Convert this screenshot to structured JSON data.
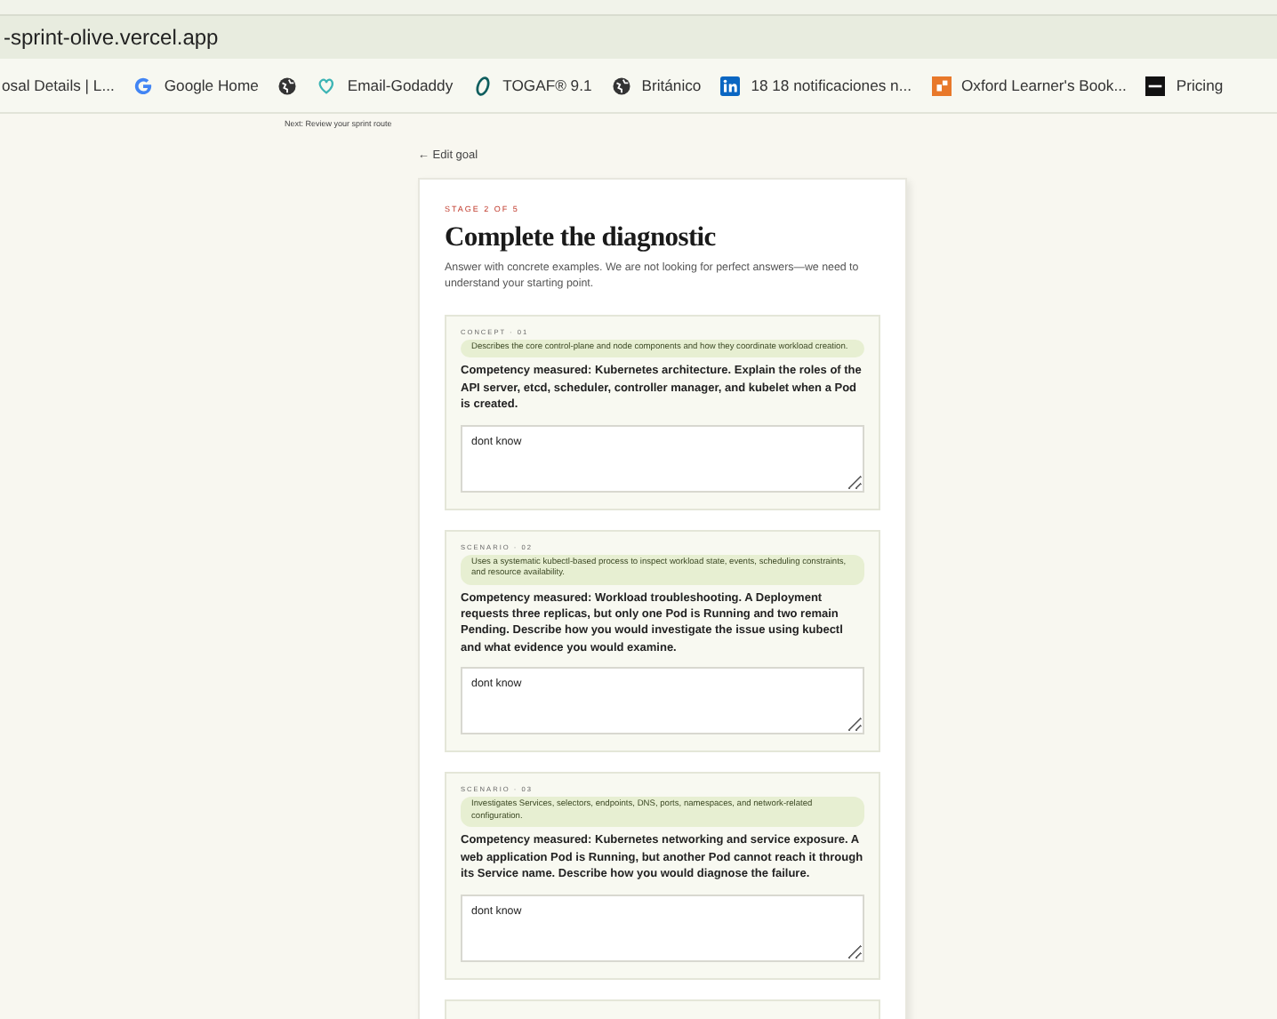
{
  "browser": {
    "url": "-sprint-olive.vercel.app",
    "bookmarks": [
      {
        "kind": "none",
        "label": "osal Details | L..."
      },
      {
        "kind": "google",
        "label": "Google Home"
      },
      {
        "kind": "globe"
      },
      {
        "kind": "godaddy",
        "label": "Email-Godaddy"
      },
      {
        "kind": "togaf",
        "label": "TOGAF® 9.1"
      },
      {
        "kind": "globe",
        "label": "Británico"
      },
      {
        "kind": "linkedin",
        "label": "18 18 notificaciones n..."
      },
      {
        "kind": "oxford",
        "label": "Oxford Learner's Book..."
      },
      {
        "kind": "pricing",
        "label": "Pricing"
      }
    ]
  },
  "next_hint": "Next: Review your sprint route",
  "back_link": "← Edit goal",
  "stage": "STAGE 2 OF 5",
  "title": "Complete the diagnostic",
  "intro": "Answer with concrete examples. We are not looking for perfect answers—we need to understand your starting point.",
  "questions": [
    {
      "tag": "CONCEPT · 01",
      "criterion": "Describes the core control-plane and node components and how they coordinate workload creation.",
      "prompt": "Competency measured: Kubernetes architecture. Explain the roles of the API server, etcd, scheduler, controller manager, and kubelet when a Pod is created.",
      "answer": "dont know"
    },
    {
      "tag": "SCENARIO · 02",
      "criterion": "Uses a systematic kubectl-based process to inspect workload state, events, scheduling constraints, and resource availability.",
      "prompt": "Competency measured: Workload troubleshooting. A Deployment requests three replicas, but only one Pod is Running and two remain Pending. Describe how you would investigate the issue using kubectl and what evidence you would examine.",
      "answer": "dont know"
    },
    {
      "tag": "SCENARIO · 03",
      "criterion": "Investigates Services, selectors, endpoints, DNS, ports, namespaces, and network-related configuration.",
      "prompt": "Competency measured: Kubernetes networking and service exposure. A web application Pod is Running, but another Pod cannot reach it through its Service name. Describe how you would diagnose the failure.",
      "answer": "dont know"
    }
  ]
}
